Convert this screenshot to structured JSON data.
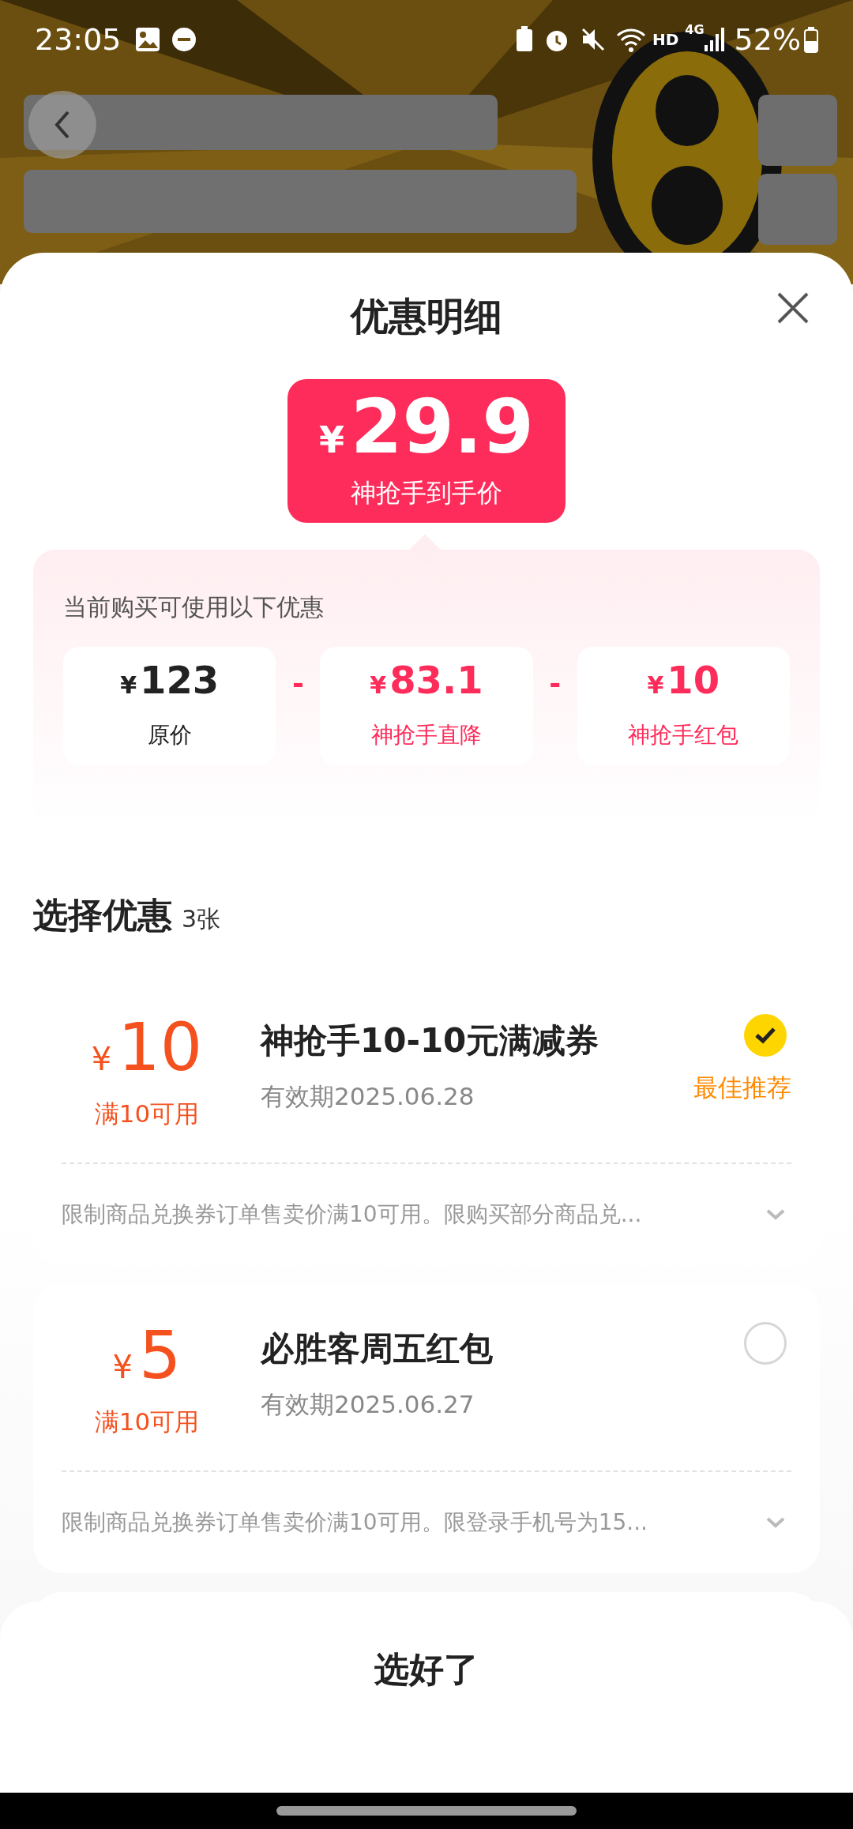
{
  "status_bar": {
    "time": "23:05",
    "network": "HD",
    "cellular": "4G",
    "battery": "52%"
  },
  "sheet": {
    "title": "优惠明细"
  },
  "final_price": {
    "currency": "¥",
    "amount": "29.9",
    "label": "神抢手到手价"
  },
  "breakdown": {
    "heading": "当前购买可使用以下优惠",
    "operator": "-",
    "items": [
      {
        "kind": "base",
        "currency": "¥",
        "amount": "123",
        "label": "原价"
      },
      {
        "kind": "discount",
        "currency": "¥",
        "amount": "83.1",
        "label": "神抢手直降"
      },
      {
        "kind": "discount",
        "currency": "¥",
        "amount": "10",
        "label": "神抢手红包"
      }
    ]
  },
  "coupons": {
    "heading": "选择优惠",
    "count": "3张",
    "items": [
      {
        "currency": "¥",
        "amount": "10",
        "condition": "满10可用",
        "title": "神抢手10-10元满减券",
        "validity": "有效期2025.06.28",
        "note": "限制商品兑换券订单售卖价满10可用。限购买部分商品兑...",
        "tag": "最佳推荐",
        "selected": true
      },
      {
        "currency": "¥",
        "amount": "5",
        "condition": "满10可用",
        "title": "必胜客周五红包",
        "validity": "有效期2025.06.27",
        "note": "限制商品兑换券订单售卖价满10可用。限登录手机号为15...",
        "selected": false
      }
    ]
  },
  "confirm_button": "选好了"
}
